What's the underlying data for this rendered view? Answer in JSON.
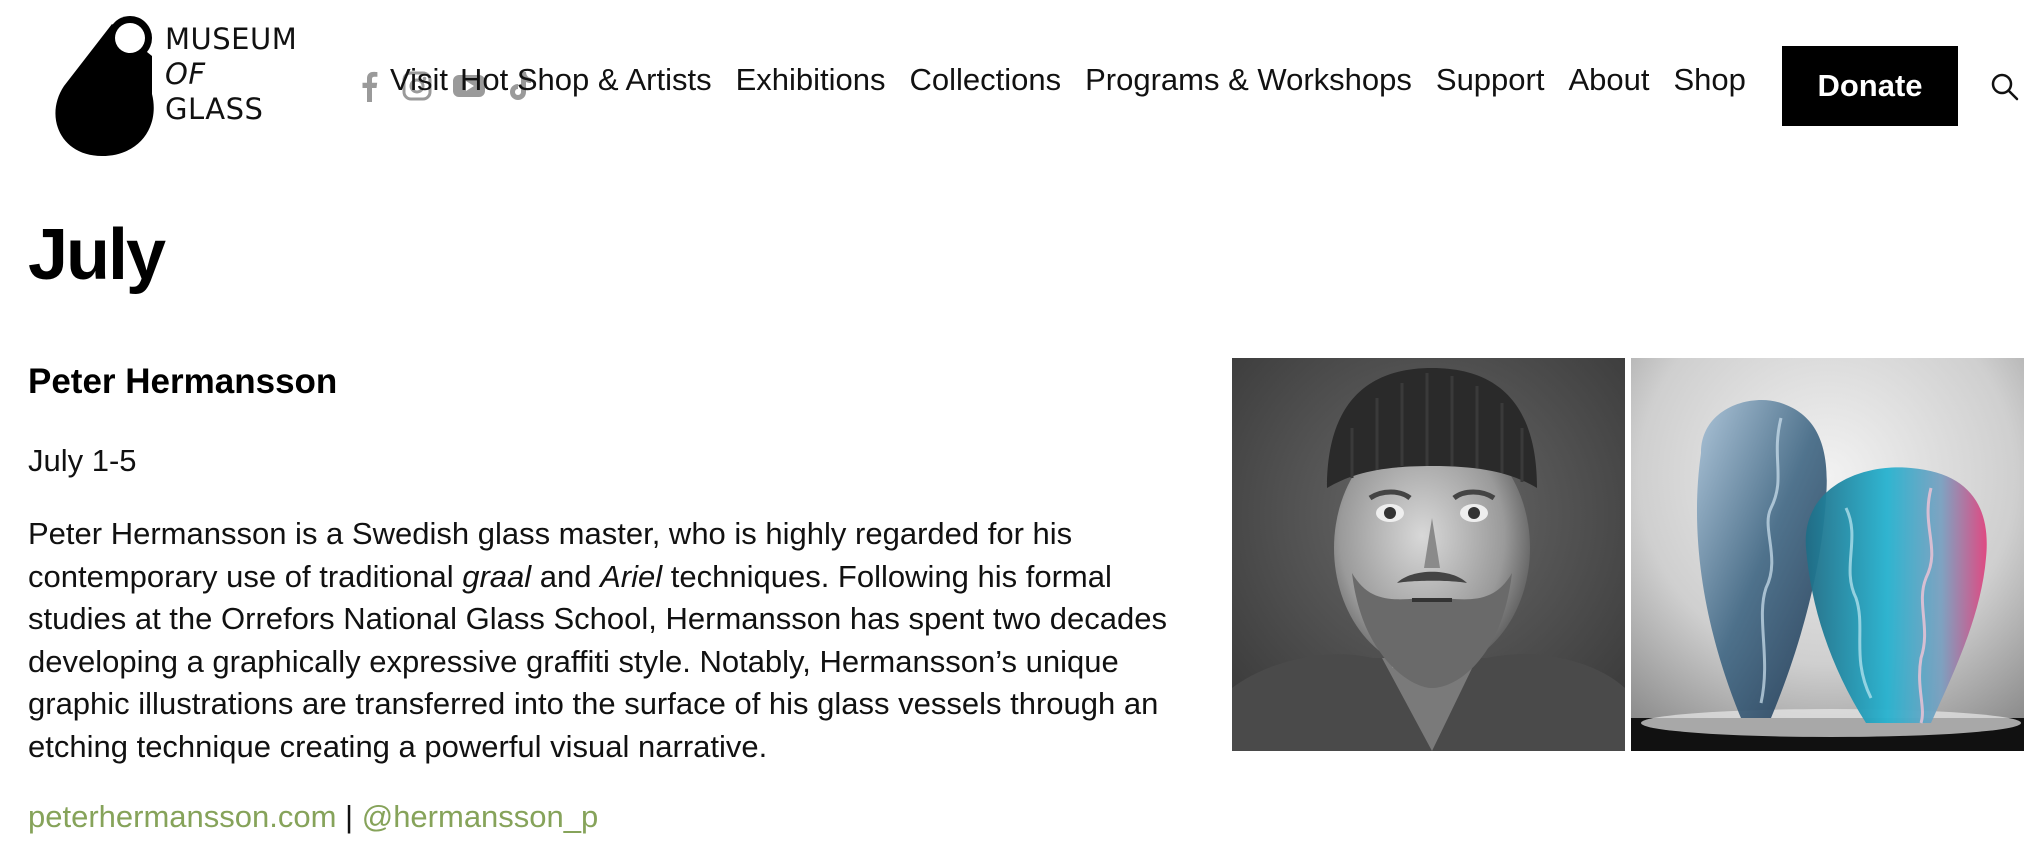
{
  "header": {
    "logo": {
      "line1": "MUSEUM",
      "line2": "OF",
      "line3": "GLASS"
    },
    "social_icons": [
      "facebook-icon",
      "instagram-icon",
      "youtube-icon",
      "tiktok-icon"
    ],
    "nav": {
      "items": [
        {
          "label": "Visit"
        },
        {
          "label": "Hot Shop & Artists"
        },
        {
          "label": "Exhibitions"
        },
        {
          "label": "Collections"
        },
        {
          "label": "Programs & Workshops"
        },
        {
          "label": "Support"
        },
        {
          "label": "About"
        },
        {
          "label": "Shop"
        }
      ]
    },
    "donate_label": "Donate"
  },
  "page": {
    "title": "July"
  },
  "artist": {
    "name": "Peter Hermansson",
    "dates": "July 1-5",
    "bio": {
      "p1": "Peter Hermansson is a Swedish glass master, who is highly regarded for his contemporary use of traditional ",
      "em1": "graal",
      "p2": " and ",
      "em2": "Ariel",
      "p3": " techniques. Following his formal studies at the Orrefors National Glass School, Hermansson has spent two decades developing a graphically expressive graffiti style. Notably, Hermansson’s unique graphic illustrations are transferred into the surface of his glass vessels through an etching technique creating a powerful visual narrative."
    },
    "website": "peterhermansson.com",
    "separator": " | ",
    "handle": "@hermansson_p"
  },
  "colors": {
    "link_green": "#86a35a",
    "donate_bg": "#000000",
    "social_gray": "#9a9a9a"
  }
}
